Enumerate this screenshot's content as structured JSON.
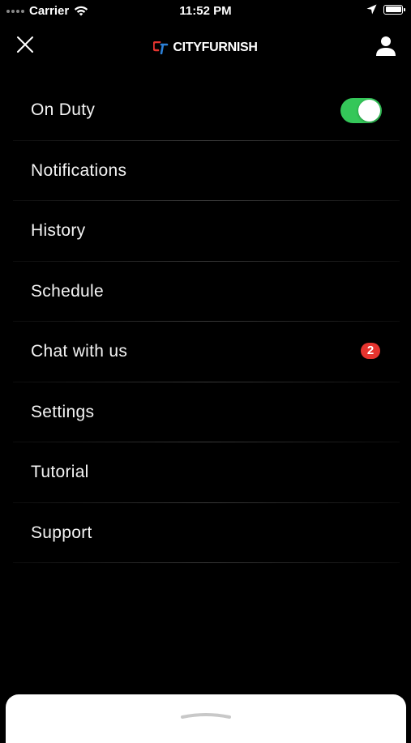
{
  "status_bar": {
    "carrier": "Carrier",
    "time": "11:52 PM",
    "icons": [
      "wifi-icon",
      "location-arrow-icon",
      "battery-icon"
    ]
  },
  "header": {
    "logo_text": "CITYFURNISH",
    "close_icon": "close-icon",
    "profile_icon": "profile-icon"
  },
  "menu": {
    "items": [
      {
        "label": "On Duty",
        "control": "toggle",
        "toggle_on": true
      },
      {
        "label": "Notifications"
      },
      {
        "label": "History"
      },
      {
        "label": "Schedule"
      },
      {
        "label": "Chat with us",
        "badge": "2"
      },
      {
        "label": "Settings"
      },
      {
        "label": "Tutorial"
      },
      {
        "label": "Support"
      }
    ]
  },
  "colors": {
    "background": "#000000",
    "toggle_on": "#34c759",
    "badge": "#e5342f",
    "logo_red": "#e5342f",
    "logo_blue": "#2c7fd6"
  }
}
